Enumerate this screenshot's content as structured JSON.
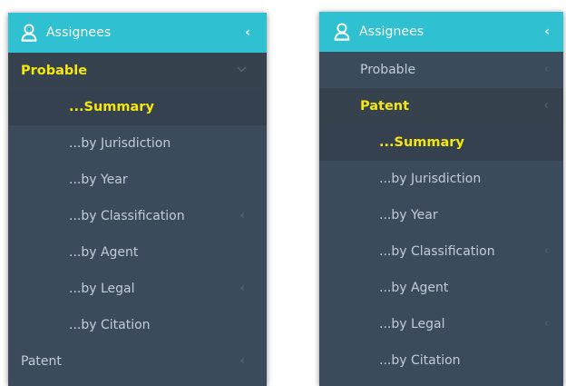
{
  "panels": [
    {
      "header": {
        "title": "Assignees",
        "collapse_glyph": "‹",
        "icon": "user-icon"
      },
      "items": [
        {
          "label": "Probable",
          "kind": "top",
          "state": "open-active",
          "chevron": "down"
        },
        {
          "label": "...Summary",
          "kind": "sub",
          "state": "selected"
        },
        {
          "label": "...by Jurisdiction",
          "kind": "sub"
        },
        {
          "label": "...by Year",
          "kind": "sub"
        },
        {
          "label": "...by Classification",
          "kind": "sub",
          "chevron": "left"
        },
        {
          "label": "...by Agent",
          "kind": "sub"
        },
        {
          "label": "...by Legal",
          "kind": "sub",
          "chevron": "left"
        },
        {
          "label": "...by Citation",
          "kind": "sub"
        },
        {
          "label": "Patent",
          "kind": "top",
          "chevron": "left"
        }
      ]
    },
    {
      "header": {
        "title": "Assignees",
        "collapse_glyph": "‹",
        "icon": "user-icon"
      },
      "items": [
        {
          "label": "Probable",
          "kind": "top",
          "chevron": "left"
        },
        {
          "label": "Patent",
          "kind": "top",
          "state": "open-active",
          "chevron": "left"
        },
        {
          "label": "...Summary",
          "kind": "sub",
          "state": "selected"
        },
        {
          "label": "...by Jurisdiction",
          "kind": "sub"
        },
        {
          "label": "...by Year",
          "kind": "sub"
        },
        {
          "label": "...by Classification",
          "kind": "sub",
          "chevron": "left"
        },
        {
          "label": "...by Agent",
          "kind": "sub"
        },
        {
          "label": "...by Legal",
          "kind": "sub",
          "chevron": "left"
        },
        {
          "label": "...by Citation",
          "kind": "sub"
        }
      ]
    }
  ],
  "colors": {
    "header_bg": "#2fc1d1",
    "menu_bg": "#3c4b5b",
    "menu_text": "#c3ccd6",
    "active_text": "#f6e711",
    "chevron": "#57677a"
  }
}
